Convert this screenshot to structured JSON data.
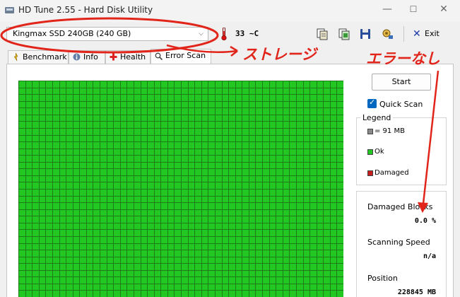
{
  "window": {
    "title": "HD Tune 2.55 - Hard Disk Utility",
    "minimize": "—",
    "maximize": "☐",
    "close": "✕"
  },
  "toolbar": {
    "drive": "Kingmax SSD 240GB (240 GB)",
    "temperature": "33 ~C",
    "exit_label": "Exit"
  },
  "tabs": [
    {
      "label": "Benchmark"
    },
    {
      "label": "Info"
    },
    {
      "label": "Health"
    },
    {
      "label": "Error Scan"
    }
  ],
  "scan": {
    "start_label": "Start",
    "quick_scan_label": "Quick Scan",
    "quick_scan_checked": true,
    "legend_title": "Legend",
    "legend": [
      {
        "label": "= 91 MB",
        "color": "#8a8a8a"
      },
      {
        "label": "Ok",
        "color": "#22c722"
      },
      {
        "label": "Damaged",
        "color": "#c81e1e"
      }
    ],
    "damaged_blocks_label": "Damaged Blocks",
    "damaged_blocks_value": "0.0 %",
    "scanning_speed_label": "Scanning Speed",
    "scanning_speed_value": "n/a",
    "position_label": "Position",
    "position_value": "228845 MB"
  },
  "annotations": {
    "storage": "ストレージ",
    "no_errors": "エラーなし",
    "color": "#e1251b"
  },
  "colors": {
    "ok_block": "#22c722",
    "grid_line": "#1a7d1a"
  }
}
